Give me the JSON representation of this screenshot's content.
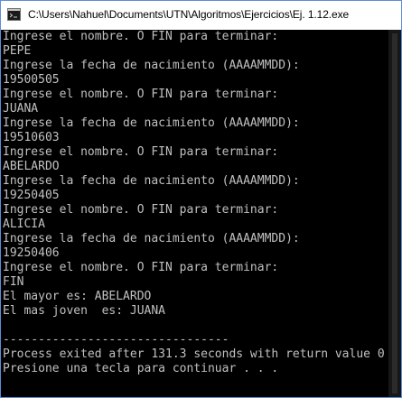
{
  "window": {
    "title": "C:\\Users\\Nahuel\\Documents\\UTN\\Algoritmos\\Ejercicios\\Ej. 1.12.exe",
    "icon": "console-app-icon"
  },
  "console": {
    "lines": [
      "Ingrese el nombre. O FIN para terminar:",
      "PEPE",
      "Ingrese la fecha de nacimiento (AAAAMMDD):",
      "19500505",
      "Ingrese el nombre. O FIN para terminar:",
      "JUANA",
      "Ingrese la fecha de nacimiento (AAAAMMDD):",
      "19510603",
      "Ingrese el nombre. O FIN para terminar:",
      "ABELARDO",
      "Ingrese la fecha de nacimiento (AAAAMMDD):",
      "19250405",
      "Ingrese el nombre. O FIN para terminar:",
      "ALICIA",
      "Ingrese la fecha de nacimiento (AAAAMMDD):",
      "19250406",
      "Ingrese el nombre. O FIN para terminar:",
      "FIN",
      "El mayor es: ABELARDO",
      "El mas joven  es: JUANA",
      "",
      "--------------------------------",
      "Process exited after 131.3 seconds with return value 0",
      "Presione una tecla para continuar . . ."
    ]
  },
  "colors": {
    "console_background": "#000000",
    "console_text": "#c0c0c0",
    "titlebar_background": "#ffffff",
    "window_border": "#5a8fd6"
  }
}
